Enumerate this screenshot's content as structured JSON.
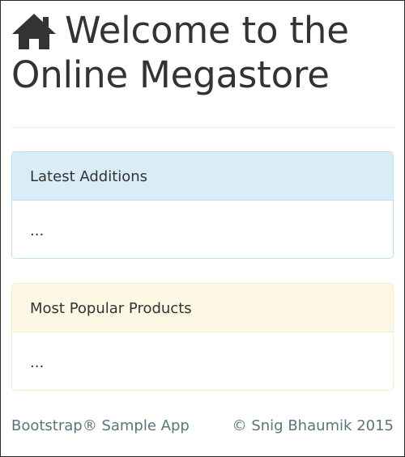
{
  "header": {
    "icon": "home-icon",
    "title_line1": "Welcome to the",
    "title_line2": "Online Megastore"
  },
  "panels": [
    {
      "heading": "Latest Additions",
      "body": "...",
      "heading_color": "#d8edf7",
      "border_color": "#bfe0ef"
    },
    {
      "heading": "Most Popular Products",
      "body": "...",
      "heading_color": "#fcf8e3",
      "border_color": "#f3ebd0"
    }
  ],
  "footer": {
    "left": "Bootstrap® Sample App",
    "right": "© Snig Bhaumik 2015",
    "color": "#59757f"
  }
}
